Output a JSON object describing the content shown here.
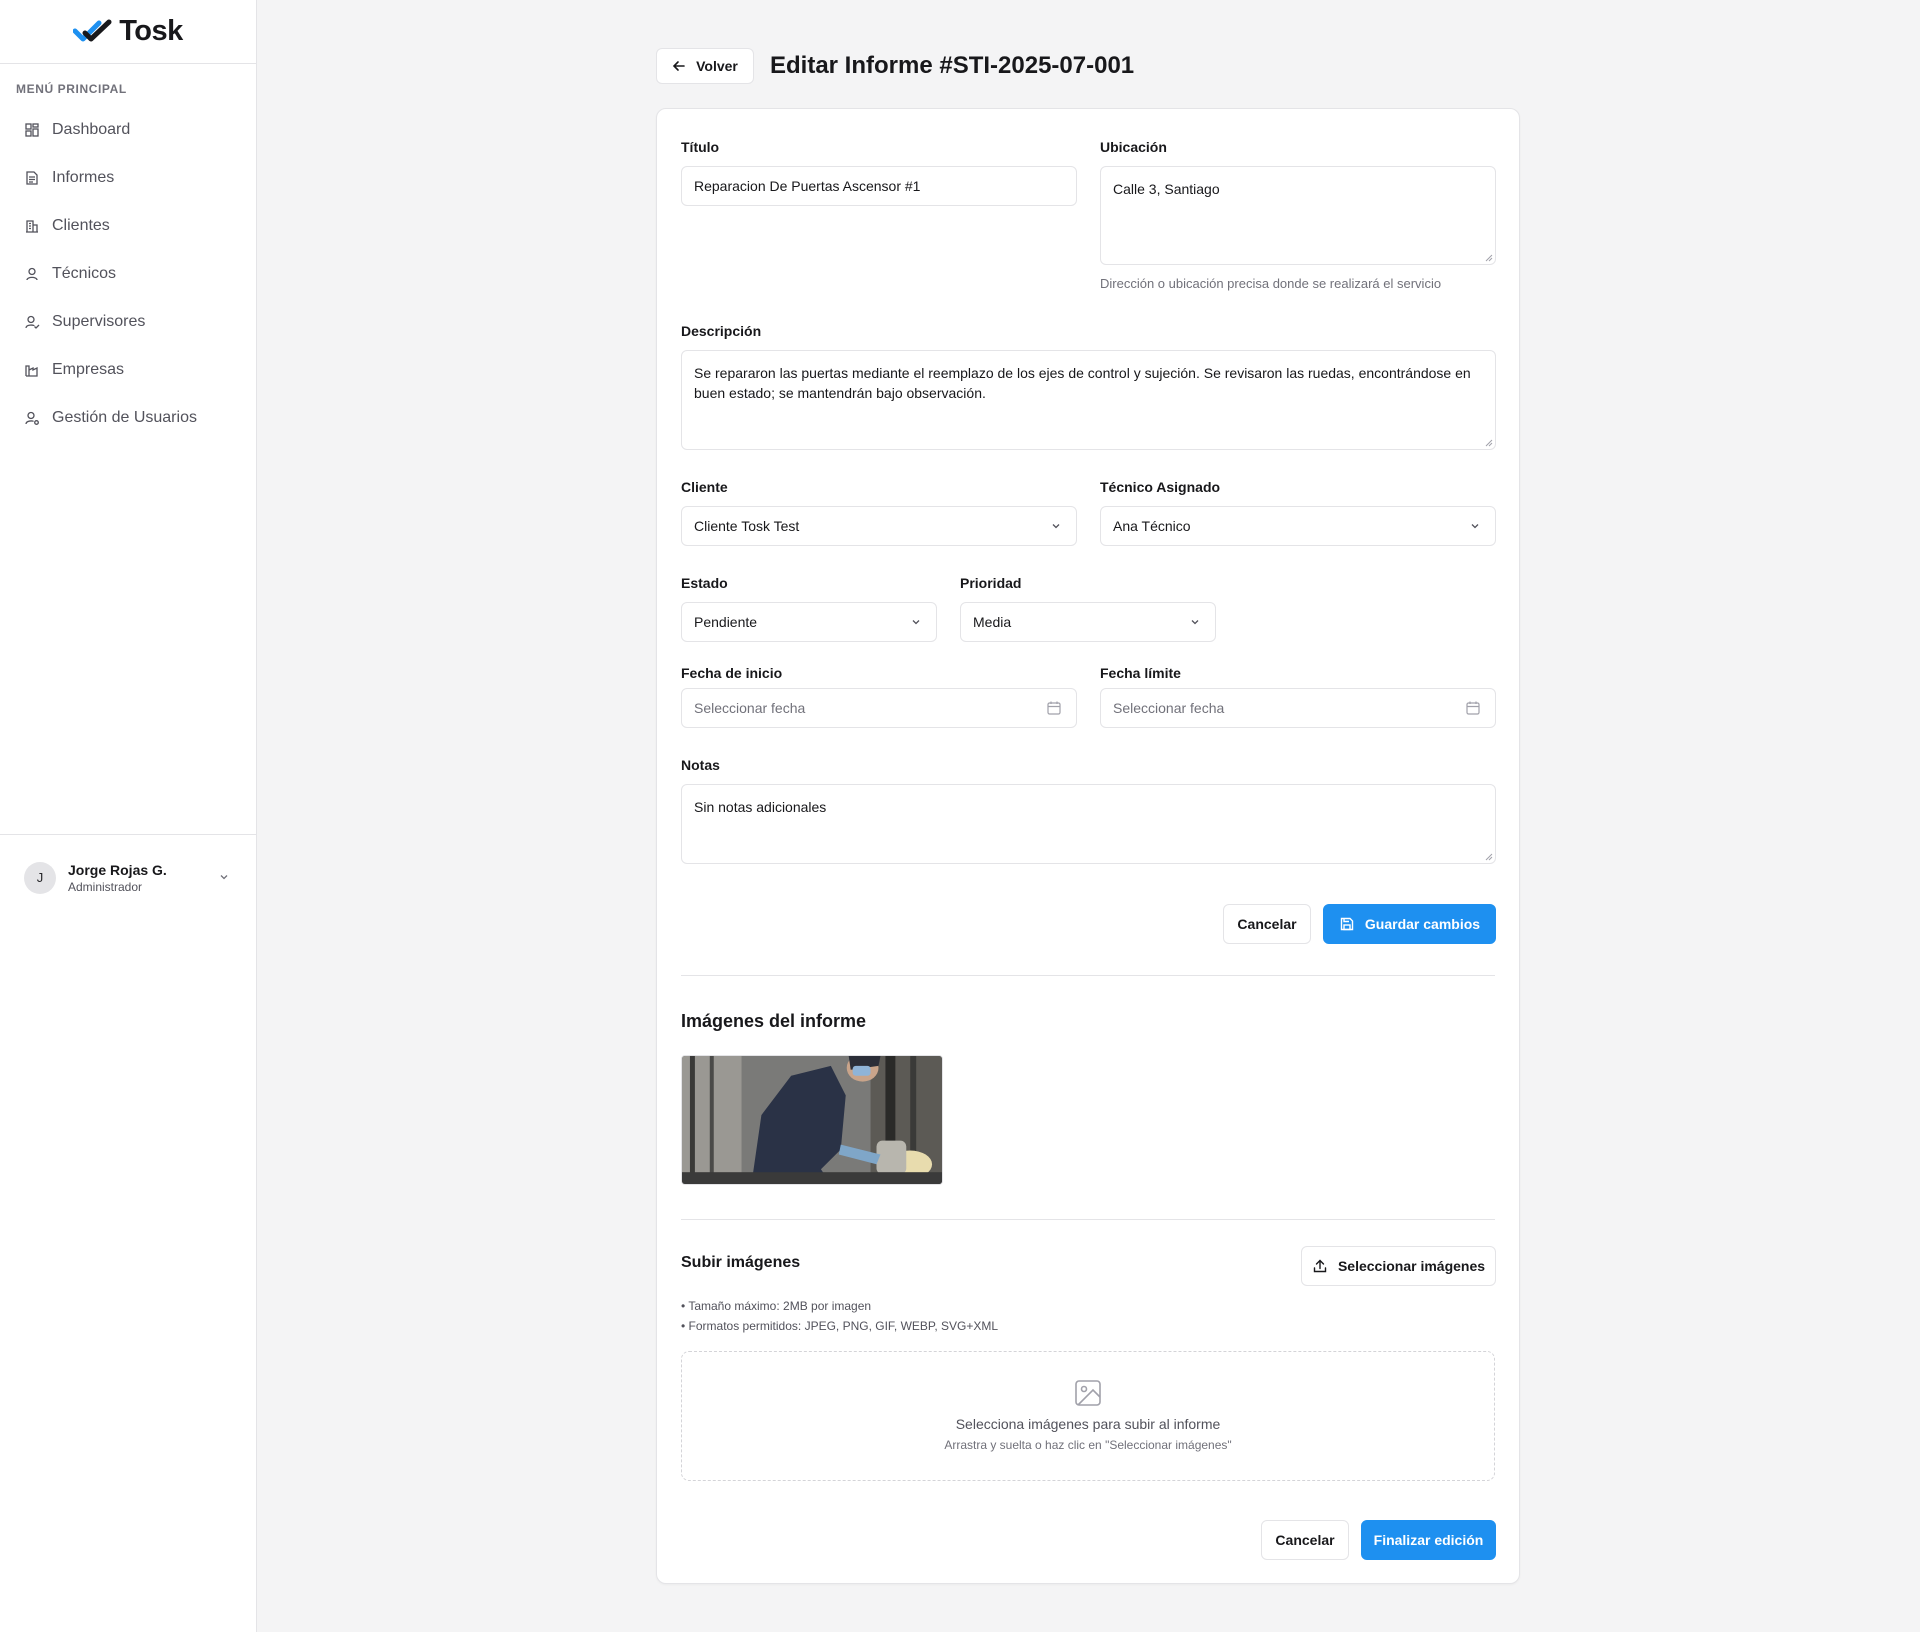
{
  "brand": {
    "name": "Tosk",
    "accent": "#1e90f0"
  },
  "sidebar": {
    "section_title": "MENÚ PRINCIPAL",
    "items": [
      {
        "label": "Dashboard",
        "icon": "dashboard-icon"
      },
      {
        "label": "Informes",
        "icon": "document-icon"
      },
      {
        "label": "Clientes",
        "icon": "building-icon"
      },
      {
        "label": "Técnicos",
        "icon": "user-icon"
      },
      {
        "label": "Supervisores",
        "icon": "user-check-icon"
      },
      {
        "label": "Empresas",
        "icon": "factory-icon"
      },
      {
        "label": "Gestión de Usuarios",
        "icon": "user-cog-icon"
      }
    ],
    "user": {
      "initial": "J",
      "name": "Jorge Rojas G.",
      "role": "Administrador"
    }
  },
  "header": {
    "back_label": "Volver",
    "title": "Editar Informe #STI-2025-07-001"
  },
  "form": {
    "titulo": {
      "label": "Título",
      "value": "Reparacion De Puertas Ascensor #1"
    },
    "ubicacion": {
      "label": "Ubicación",
      "value": "Calle 3, Santiago",
      "hint": "Dirección o ubicación precisa donde se realizará el servicio"
    },
    "descripcion": {
      "label": "Descripción",
      "value": "Se repararon las puertas mediante el reemplazo de los ejes de control y sujeción.  Se revisaron las ruedas, encontrándose en buen estado; se mantendrán bajo observación."
    },
    "cliente": {
      "label": "Cliente",
      "value": "Cliente Tosk Test"
    },
    "tecnico": {
      "label": "Técnico Asignado",
      "value": "Ana Técnico"
    },
    "estado": {
      "label": "Estado",
      "value": "Pendiente"
    },
    "prioridad": {
      "label": "Prioridad",
      "value": "Media"
    },
    "fecha_inicio": {
      "label": "Fecha de inicio",
      "placeholder": "Seleccionar fecha"
    },
    "fecha_limite": {
      "label": "Fecha límite",
      "placeholder": "Seleccionar fecha"
    },
    "notas": {
      "label": "Notas",
      "value": "Sin notas adicionales"
    },
    "cancel_label": "Cancelar",
    "save_label": "Guardar cambios"
  },
  "images": {
    "title": "Imágenes del informe"
  },
  "upload": {
    "title": "Subir imágenes",
    "select_label": "Seleccionar imágenes",
    "note_size": "• Tamaño máximo: 2MB por imagen",
    "note_formats": "• Formatos permitidos: JPEG, PNG, GIF, WEBP, SVG+XML",
    "dropzone_main": "Selecciona imágenes para subir al informe",
    "dropzone_sub": "Arrastra y suelta o haz clic en \"Seleccionar imágenes\""
  },
  "footer": {
    "cancel_label": "Cancelar",
    "finish_label": "Finalizar edición"
  }
}
